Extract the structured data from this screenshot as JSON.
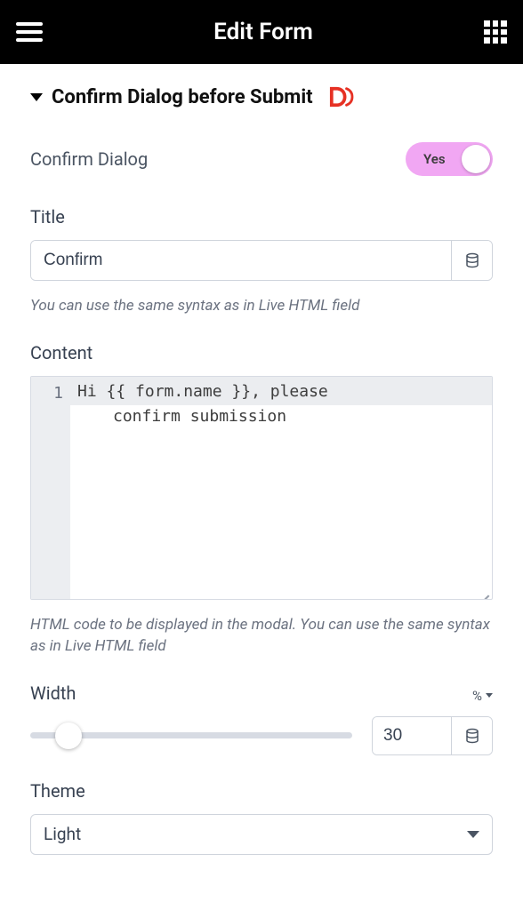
{
  "header": {
    "title": "Edit Form"
  },
  "section": {
    "title": "Confirm Dialog before Submit"
  },
  "confirm_dialog": {
    "label": "Confirm Dialog",
    "toggle_label": "Yes",
    "enabled": true
  },
  "title_field": {
    "label": "Title",
    "value": "Confirm",
    "help": "You can use the same syntax as in Live HTML field"
  },
  "content_field": {
    "label": "Content",
    "line_number": "1",
    "line1": "Hi {{ form.name }}, please",
    "line2": "confirm submission",
    "help": "HTML code to be displayed in the modal. You can use the same syntax as in Live HTML field"
  },
  "width_field": {
    "label": "Width",
    "unit": "%",
    "value": "30",
    "thumb_percent": 12
  },
  "theme_field": {
    "label": "Theme",
    "value": "Light"
  }
}
